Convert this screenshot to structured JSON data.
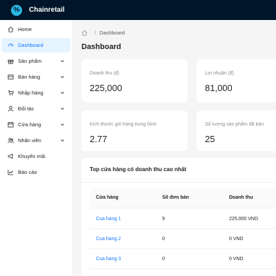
{
  "app": {
    "title": "Chainretail",
    "logo_glyph": "%"
  },
  "sidebar": {
    "items": [
      {
        "label": "Home",
        "icon": "home-icon",
        "has_caret": false,
        "active": false
      },
      {
        "label": "Dashboard",
        "icon": "dashboard-icon",
        "has_caret": false,
        "active": true
      },
      {
        "label": "Sản phẩm",
        "icon": "gift-icon",
        "has_caret": true,
        "active": false
      },
      {
        "label": "Bán hàng",
        "icon": "sales-icon",
        "has_caret": true,
        "active": false
      },
      {
        "label": "Nhập hàng",
        "icon": "cart-icon",
        "has_caret": true,
        "active": false
      },
      {
        "label": "Đối tác",
        "icon": "user-icon",
        "has_caret": true,
        "active": false
      },
      {
        "label": "Cửa hàng",
        "icon": "calendar-icon",
        "has_caret": true,
        "active": false
      },
      {
        "label": "Nhân viên",
        "icon": "team-icon",
        "has_caret": true,
        "active": false
      },
      {
        "label": "Khuyến mãi",
        "icon": "promotion-icon",
        "has_caret": false,
        "active": false
      },
      {
        "label": "Báo cáo",
        "icon": "line-chart-icon",
        "has_caret": false,
        "active": false
      }
    ]
  },
  "breadcrumb": {
    "current": "Dashboard",
    "separator": "/"
  },
  "page": {
    "title": "Dashboard"
  },
  "stats": [
    {
      "label": "Doanh thu (đ)",
      "value": "225,000"
    },
    {
      "label": "Lợi nhuận (đ)",
      "value": "81,000"
    },
    {
      "label": "Kích thước giỏ hàng trung bình",
      "value": "2.77"
    },
    {
      "label": "Số lượng sản phẩm đã bán",
      "value": "25"
    }
  ],
  "top_stores": {
    "title": "Top cửa hàng có doanh thu cao nhất",
    "columns": [
      "Cửa hàng",
      "Số đơn bán",
      "Doanh thu"
    ],
    "rows": [
      {
        "store": "Cua hang 1",
        "orders": "9",
        "revenue": "225,000 VND"
      },
      {
        "store": "Cua hang 2",
        "orders": "0",
        "revenue": "0 VND"
      },
      {
        "store": "Cua hang 3",
        "orders": "0",
        "revenue": "0 VND"
      }
    ]
  },
  "colors": {
    "topbar": "#001529",
    "accent": "#1677ff",
    "active_bg": "#e6f4ff",
    "logo": "#2ab7e3"
  }
}
